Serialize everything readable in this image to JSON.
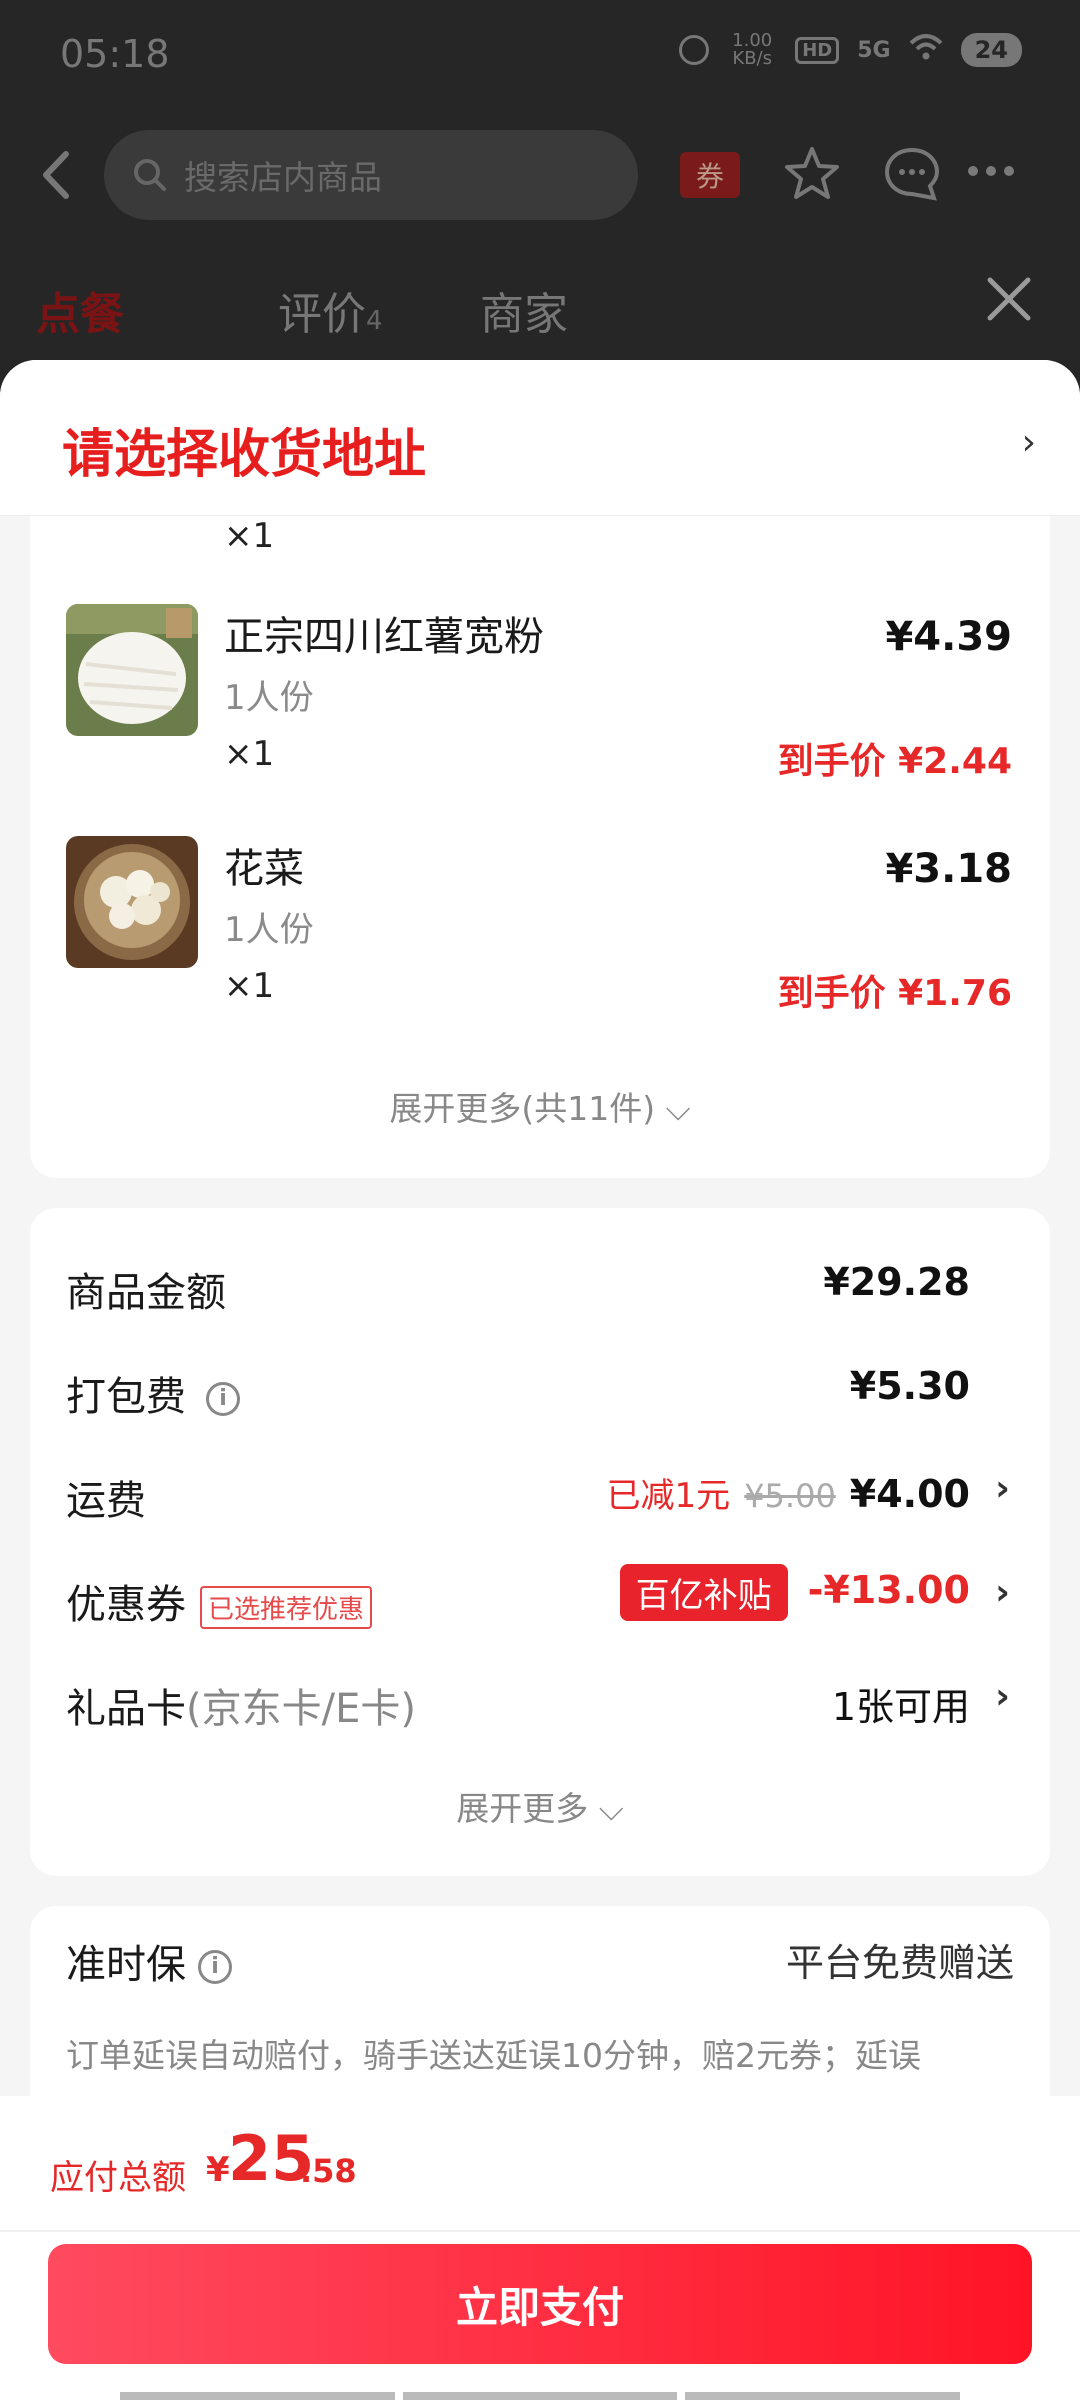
{
  "status_bar": {
    "time": "05:18",
    "net_speed": "1.00 KB/s",
    "hd": "HD",
    "signal": "5G",
    "battery": "24"
  },
  "topbar": {
    "search_placeholder": "搜索店内商品",
    "coupon": "券"
  },
  "tabs": [
    {
      "label": "点餐",
      "suffix": ""
    },
    {
      "label": "评价",
      "suffix": "4"
    },
    {
      "label": "商家",
      "suffix": ""
    }
  ],
  "address": {
    "title": "请选择收货地址",
    "chevron": "›"
  },
  "items": {
    "partial_qty": "×1",
    "list": [
      {
        "name": "正宗四川红薯宽粉",
        "spec": "1人份",
        "qty": "×1",
        "price": "¥4.39",
        "final": "到手价 ¥2.44"
      },
      {
        "name": "花菜",
        "spec": "1人份",
        "qty": "×1",
        "price": "¥3.18",
        "final": "到手价 ¥1.76"
      }
    ],
    "expand": "展开更多(共11件) ⌵"
  },
  "fees": {
    "goods": {
      "label": "商品金额",
      "value": "¥29.28"
    },
    "packing": {
      "label": "打包费",
      "value": "¥5.30"
    },
    "delivery": {
      "label": "运费",
      "reduce": "已减1元",
      "original": "¥5.00",
      "value": "¥4.00"
    },
    "coupon": {
      "label": "优惠券",
      "badge": "已选推荐优惠",
      "subsidy": "百亿补贴",
      "value": "-¥13.00"
    },
    "giftcard": {
      "label": "礼品卡",
      "label_muted": "(京东卡/E卡)",
      "value": "1张可用"
    },
    "expand": "展开更多 ⌵"
  },
  "ontime": {
    "title": "准时保",
    "right": "平台免费赠送",
    "desc": "订单延误自动赔付，骑手送达延误10分钟，赔2元券；延误"
  },
  "footer": {
    "total_label": "应付总额",
    "currency": "¥",
    "total_int": "25",
    "total_dec": ".58",
    "pay_button": "立即支付"
  },
  "colors": {
    "accent": "#e62828",
    "pay_gradient_start": "#ff4a5f",
    "pay_gradient_end": "#ff1426"
  }
}
